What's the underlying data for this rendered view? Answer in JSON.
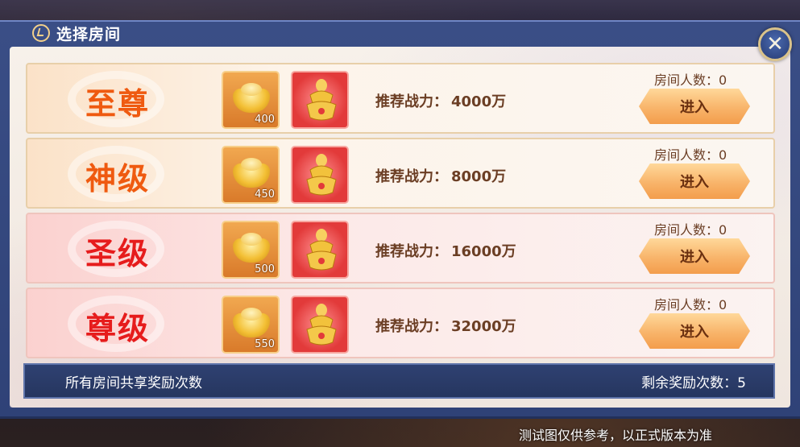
{
  "header": {
    "title": "选择房间"
  },
  "rooms": [
    {
      "name": "至尊",
      "style": "gold",
      "ingot_count": "400",
      "recommend_label": "推荐战力：",
      "recommend_value": "4000万",
      "count_label": "房间人数：0",
      "enter_label": "进入"
    },
    {
      "name": "神级",
      "style": "gold",
      "ingot_count": "450",
      "recommend_label": "推荐战力：",
      "recommend_value": "8000万",
      "count_label": "房间人数：0",
      "enter_label": "进入"
    },
    {
      "name": "圣级",
      "style": "red",
      "ingot_count": "500",
      "recommend_label": "推荐战力：",
      "recommend_value": "16000万",
      "count_label": "房间人数：0",
      "enter_label": "进入"
    },
    {
      "name": "尊级",
      "style": "red",
      "ingot_count": "550",
      "recommend_label": "推荐战力：",
      "recommend_value": "32000万",
      "count_label": "房间人数：0",
      "enter_label": "进入"
    }
  ],
  "footer": {
    "shared_label": "所有房间共享奖励次数",
    "remaining_label": "剩余奖励次数：5"
  },
  "disclaimer": "测试图仅供参考，以正式版本为准",
  "icons": {
    "close": "close-icon",
    "ingot": "gold-ingot-icon",
    "treasure": "treasure-icon",
    "title": "back-arrow-icon"
  },
  "colors": {
    "gold_name": "#ef5a10",
    "red_name": "#e61c1c",
    "button": "#f8b46a",
    "frame": "#2f4277"
  }
}
